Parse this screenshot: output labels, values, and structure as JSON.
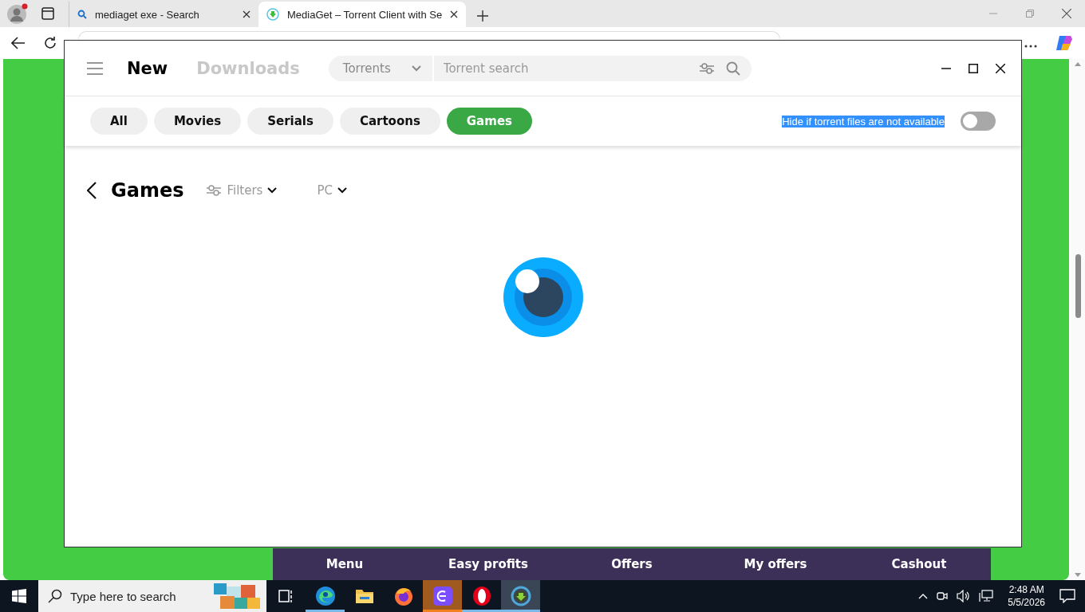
{
  "browser": {
    "tabs": [
      {
        "title": "mediaget exe - Search",
        "selected": false
      },
      {
        "title": "MediaGet – Torrent Client with Se",
        "selected": true
      }
    ],
    "page": {
      "bottom_nav": [
        "Menu",
        "Easy profits",
        "Offers",
        "My offers",
        "Cashout"
      ]
    }
  },
  "app": {
    "sections": [
      {
        "label": "New",
        "selected": true
      },
      {
        "label": "Downloads",
        "selected": false
      }
    ],
    "search": {
      "scope": "Torrents",
      "placeholder": "Torrent search"
    },
    "categories": [
      {
        "label": "All",
        "selected": false
      },
      {
        "label": "Movies",
        "selected": false
      },
      {
        "label": "Serials",
        "selected": false
      },
      {
        "label": "Cartoons",
        "selected": false
      },
      {
        "label": "Games",
        "selected": true
      }
    ],
    "availability_filter": {
      "label": "Hide if torrent files are not available",
      "highlighted": true,
      "on": false
    },
    "heading": {
      "title": "Games",
      "filters": "Filters",
      "platform": "PC"
    },
    "loading": true
  },
  "taskbar": {
    "search_placeholder": "Type here to search",
    "apps": [
      {
        "kind": "taskview",
        "running": false,
        "attention": false,
        "selected": false
      },
      {
        "kind": "edge",
        "running": true,
        "attention": false,
        "selected": false
      },
      {
        "kind": "explorer",
        "running": false,
        "attention": false,
        "selected": false
      },
      {
        "kind": "firefox",
        "running": false,
        "attention": false,
        "selected": false
      },
      {
        "kind": "purple",
        "running": false,
        "attention": true,
        "selected": false
      },
      {
        "kind": "opera",
        "running": true,
        "attention": false,
        "selected": false
      },
      {
        "kind": "mediaget",
        "running": false,
        "attention": false,
        "selected": true
      }
    ],
    "clock": {
      "time": "2:48 AM",
      "date": "5/5/2026"
    }
  }
}
